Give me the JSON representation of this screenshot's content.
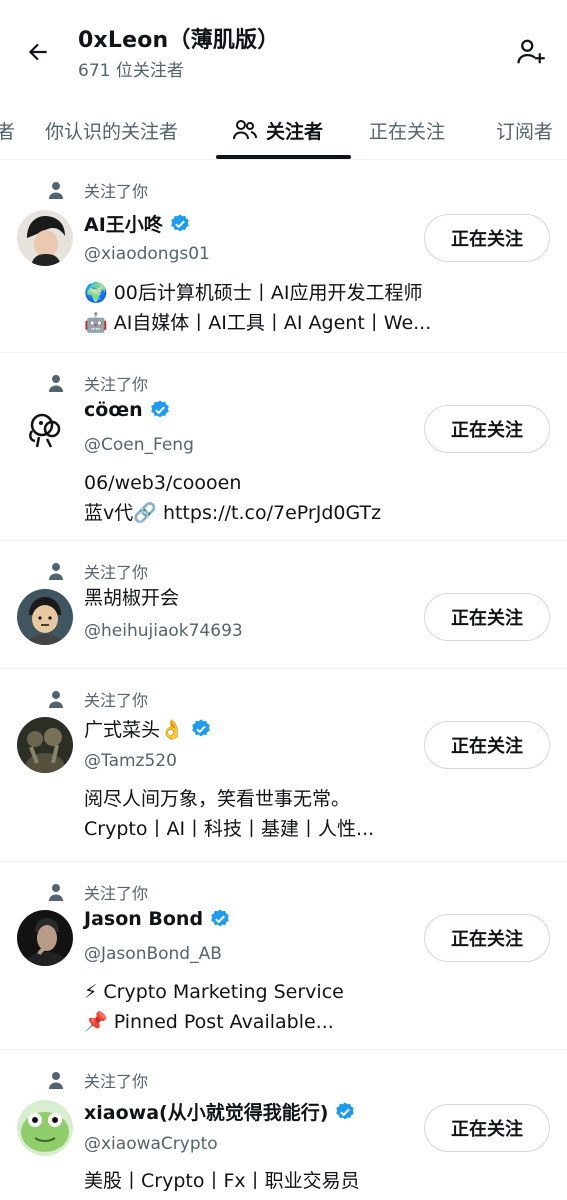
{
  "header": {
    "title": "0xLeon（薄肌版）",
    "subtitle": "671 位关注者"
  },
  "tabs": {
    "partial_left": "者",
    "items": [
      "你认识的关注者",
      "关注者",
      "正在关注",
      "订阅者"
    ],
    "active_index": 1
  },
  "follow_note": "关注了你",
  "follow_button_label": "正在关注",
  "users": [
    {
      "name": "AI王小咚",
      "verified": true,
      "handle": "@xiaodongs01",
      "follows_you": true,
      "bio": [
        "🌍 00后计算机硕士丨AI应用开发工程师",
        "🤖 AI自媒体丨AI工具丨AI Agent丨We..."
      ]
    },
    {
      "name": "cöœn",
      "verified": true,
      "handle": "@Coen_Feng",
      "follows_you": true,
      "bio": [
        "06/web3/coooen",
        "蓝v代🔗 https://t.co/7ePrJd0GTz"
      ]
    },
    {
      "name": "黑胡椒开会",
      "verified": false,
      "handle": "@heihujiaok74693",
      "follows_you": true,
      "bio": []
    },
    {
      "name": "广式菜头👌",
      "verified": true,
      "handle": "@Tamz520",
      "follows_you": true,
      "bio": [
        "阅尽人间万象，笑看世事无常。",
        "Crypto丨AI丨科技丨基建丨人性..."
      ]
    },
    {
      "name": "Jason Bond",
      "verified": true,
      "handle": "@JasonBond_AB",
      "follows_you": true,
      "bio": [
        "⚡ Crypto Marketing Service",
        "📌 Pinned Post Available..."
      ]
    },
    {
      "name": "xiaowa(从小就觉得我能行)",
      "verified": true,
      "handle": "@xiaowaCrypto",
      "follows_you": true,
      "bio": [
        "美股丨Crypto丨Fx丨职业交易员"
      ]
    }
  ],
  "colors": {
    "text": "#0f1419",
    "secondary": "#536471",
    "verified_blue": "#1d9bf0",
    "border": "#eff3f4"
  }
}
